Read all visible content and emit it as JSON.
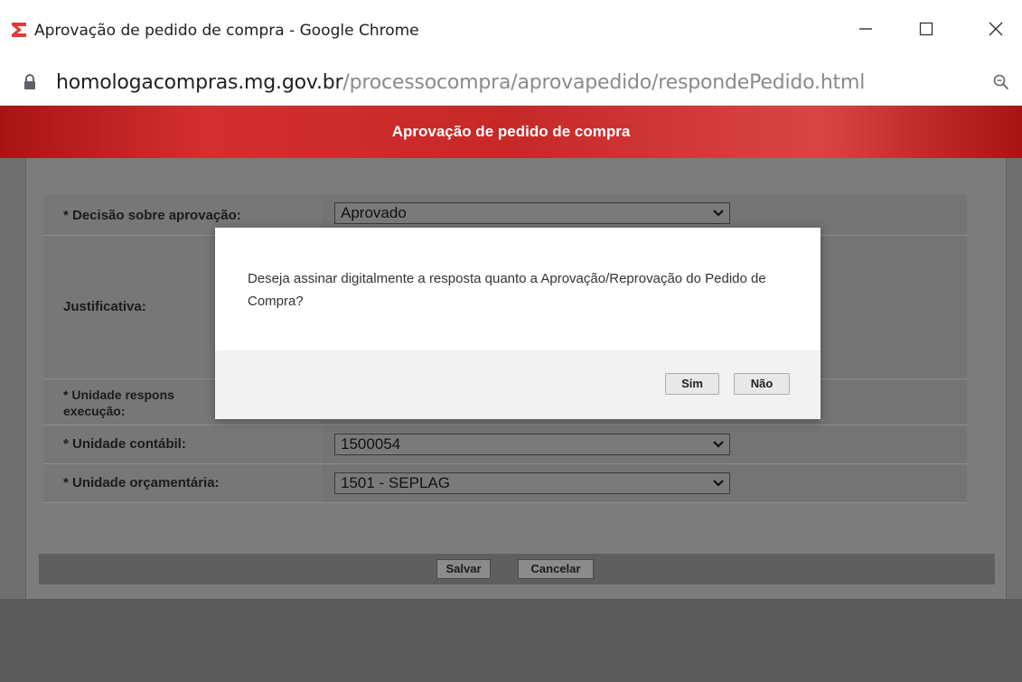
{
  "window": {
    "title": "Aprovação de pedido de compra - Google Chrome",
    "url_host": "homologacompras.mg.gov.br",
    "url_path": "/processocompra/aprovapedido/respondePedido.html",
    "icon": "sigma-logo-icon"
  },
  "header": {
    "title": "Aprovação de pedido de compra"
  },
  "form": {
    "decisao": {
      "label": "* Decisão sobre aprovação:",
      "value": "Aprovado"
    },
    "justificativa": {
      "label": "Justificativa:"
    },
    "unidade_responsavel": {
      "label": "* Unidade respons",
      "label_line2": "execução:"
    },
    "unidade_contabil": {
      "label": "* Unidade contábil:",
      "value": "1500054"
    },
    "unidade_orcamentaria": {
      "label": "* Unidade orçamentária:",
      "value": "1501 - SEPLAG"
    }
  },
  "footer": {
    "save_label": "Salvar",
    "cancel_label": "Cancelar"
  },
  "dialog": {
    "message": "Deseja assinar digitalmente a resposta quanto a Aprovação/Reprovação do Pedido de Compra?",
    "yes_label": "Sim",
    "no_label": "Não"
  },
  "colors": {
    "header_red": "#c62828",
    "overlay_gray": "#6f6f6f"
  }
}
